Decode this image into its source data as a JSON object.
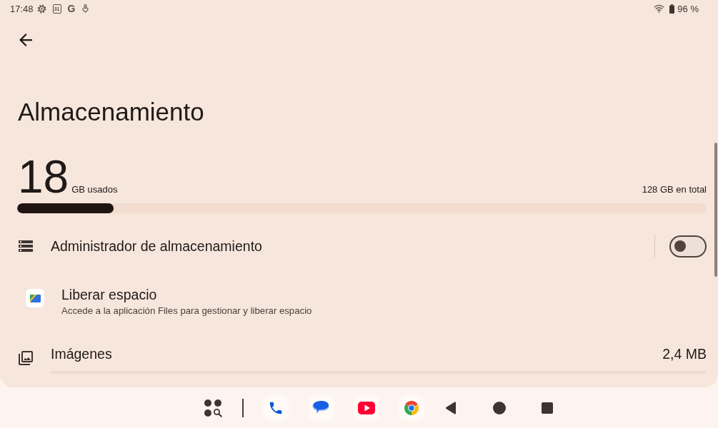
{
  "status_bar": {
    "time": "17:48",
    "calendar_day": "31",
    "letter": "G",
    "battery": "96 %"
  },
  "header": {
    "title": "Almacenamiento"
  },
  "usage": {
    "used": "18",
    "used_label": "GB usados",
    "total": "128 GB en total",
    "level": 0.14
  },
  "rows": [
    {
      "kind": "toggle",
      "title": "Administrador de almacenamiento",
      "on": false
    },
    {
      "kind": "link",
      "title": "Liberar espacio",
      "subtitle": "Accede a la aplicación Files para gestionar y liberar espacio"
    },
    {
      "kind": "category",
      "title": "Imágenes",
      "value": "2,4 MB",
      "level": 0.0
    }
  ]
}
